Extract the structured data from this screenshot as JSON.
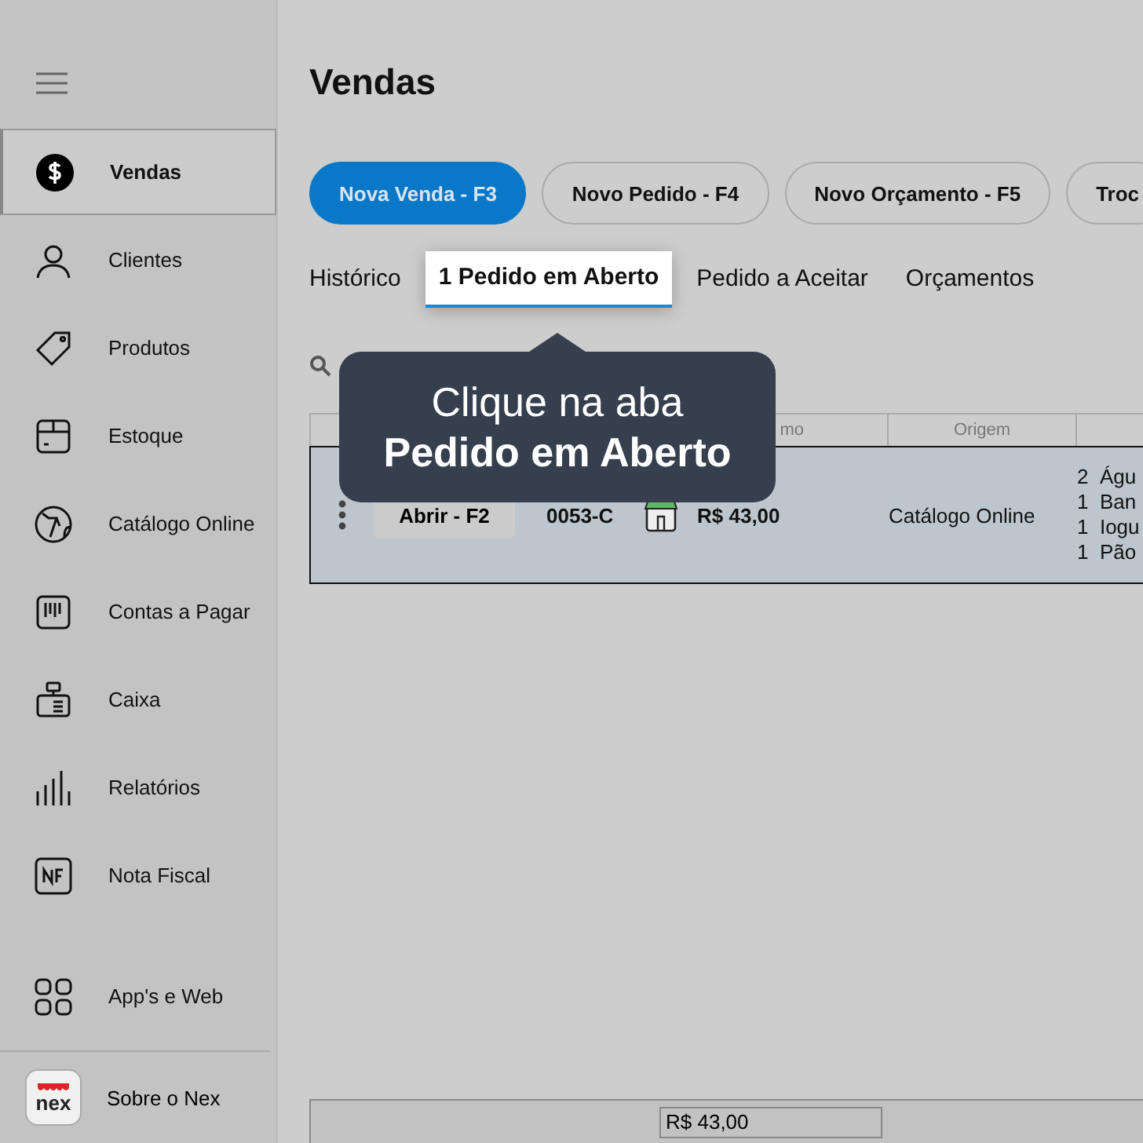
{
  "sidebar": {
    "items": [
      {
        "label": "Vendas",
        "selected": true
      },
      {
        "label": "Clientes",
        "selected": false
      },
      {
        "label": "Produtos",
        "selected": false
      },
      {
        "label": "Estoque",
        "selected": false
      },
      {
        "label": "Catálogo Online",
        "selected": false
      },
      {
        "label": "Contas a Pagar",
        "selected": false
      },
      {
        "label": "Caixa",
        "selected": false
      },
      {
        "label": "Relatórios",
        "selected": false
      },
      {
        "label": "Nota Fiscal",
        "selected": false
      }
    ],
    "bottom_items": [
      {
        "label": "App's e Web"
      }
    ],
    "about": {
      "label": "Sobre o Nex",
      "logo": "nex"
    }
  },
  "title": "Vendas",
  "action_buttons": [
    {
      "label": "Nova Venda - F3",
      "primary": true
    },
    {
      "label": "Novo Pedido - F4",
      "primary": false
    },
    {
      "label": "Novo Orçamento - F5",
      "primary": false
    },
    {
      "label": "Troc",
      "primary": false
    }
  ],
  "tabs": [
    {
      "label": "Histórico",
      "selected": false
    },
    {
      "label": "1 Pedido em Aberto",
      "selected": true
    },
    {
      "label": "Pedido a Aceitar",
      "selected": false
    },
    {
      "label": "Orçamentos",
      "selected": false
    }
  ],
  "table": {
    "columns": [
      "",
      "",
      "mo",
      "Origem",
      ""
    ],
    "rows": [
      {
        "action": "Abrir - F2",
        "code": "0053-C",
        "total": "R$ 43,00",
        "origin": "Catálogo Online",
        "selected": true,
        "items": [
          {
            "qty": "2",
            "name": "Águ"
          },
          {
            "qty": "1",
            "name": "Ban"
          },
          {
            "qty": "1",
            "name": "Iogu"
          },
          {
            "qty": "1",
            "name": "Pão"
          }
        ]
      }
    ]
  },
  "footer": {
    "total": "R$ 43,00"
  },
  "tooltip": {
    "line1": "Clique na aba",
    "line2": "Pedido em Aberto"
  }
}
